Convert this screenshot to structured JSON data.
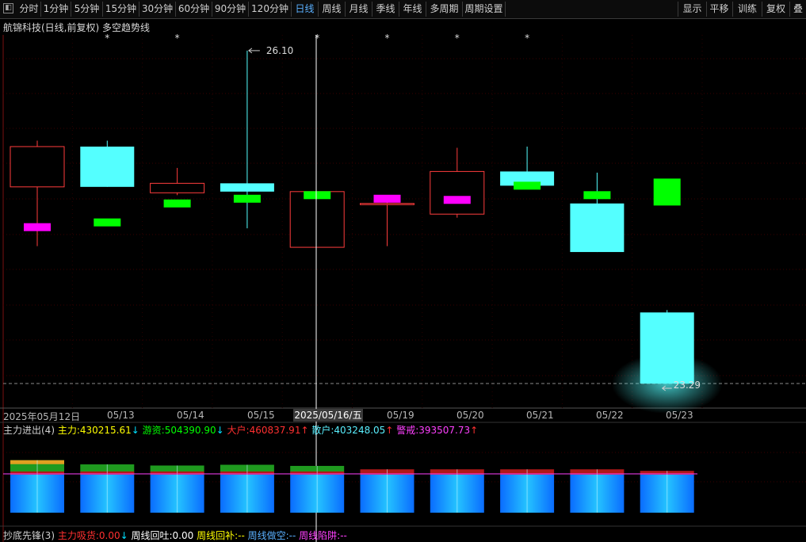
{
  "toolbar": {
    "collapse_glyph": "◧",
    "left_buttons": [
      "分时",
      "1分钟",
      "5分钟",
      "15分钟",
      "30分钟",
      "60分钟",
      "90分钟",
      "120分钟",
      "日线",
      "周线",
      "月线",
      "季线",
      "年线",
      "多周期",
      "周期设置"
    ],
    "active": "日线",
    "right_buttons": [
      "显示",
      "平移",
      "训练",
      "复权",
      "叠"
    ]
  },
  "chart_title": "航锦科技(日线,前复权) 多空趋势线",
  "markers": {
    "star": "*",
    "high_label": "26.10",
    "low_label": "23.29"
  },
  "dates": {
    "first": "2025年05月12日",
    "labels": [
      "05/13",
      "05/14",
      "05/15",
      "05/19",
      "05/20",
      "05/21",
      "05/22",
      "05/23"
    ],
    "highlight": "2025/05/16/五"
  },
  "indicator1": {
    "name": "主力进出(4)",
    "items": [
      {
        "label": "主力:",
        "value": "430215.61",
        "arrow": "↓",
        "color": "#ffff00"
      },
      {
        "label": "游资:",
        "value": "504390.90",
        "arrow": "↓",
        "color": "#00ff00"
      },
      {
        "label": "大户:",
        "value": "460837.91",
        "arrow": "↑",
        "color": "#ff3030"
      },
      {
        "label": "散户:",
        "value": "403248.05",
        "arrow": "↑",
        "color": "#5af0ff"
      },
      {
        "label": "警戒:",
        "value": "393507.73",
        "arrow": "↑",
        "color": "#ff40ff"
      }
    ]
  },
  "indicator2": {
    "name": "抄底先锋(3)",
    "items": [
      {
        "text": "主力吸货:0.00",
        "arrow": "↓",
        "color": "#ff3030"
      },
      {
        "text": "周线回吐:0.00",
        "arrow": "",
        "color": "#ffffff"
      },
      {
        "text": "周线回补:--",
        "arrow": "",
        "color": "#ffff00"
      },
      {
        "text": "周线做空:--",
        "arrow": "",
        "color": "#5ab0ff"
      },
      {
        "text": "周线陷阱:--",
        "arrow": "",
        "color": "#ff40ff"
      }
    ]
  },
  "colors": {
    "up": "#ff3d3d",
    "down": "#54ffff",
    "green": "#00ff00",
    "magenta": "#ff00ff",
    "volume": "#1aa0ff"
  },
  "chart_data": {
    "type": "candlestick",
    "dates": [
      "05/12",
      "05/13",
      "05/14",
      "05/15",
      "05/16",
      "05/19",
      "05/20",
      "05/21",
      "05/22",
      "05/23"
    ],
    "ohlc": [
      {
        "o": 24.95,
        "h": 25.34,
        "l": 24.45,
        "c": 25.29
      },
      {
        "o": 25.29,
        "h": 25.34,
        "l": 24.95,
        "c": 24.95
      },
      {
        "o": 24.9,
        "h": 25.11,
        "l": 24.88,
        "c": 24.98
      },
      {
        "o": 24.98,
        "h": 26.1,
        "l": 24.6,
        "c": 24.91
      },
      {
        "o": 24.44,
        "h": 24.91,
        "l": 24.44,
        "c": 24.91
      },
      {
        "o": 24.8,
        "h": 24.83,
        "l": 24.45,
        "c": 24.81
      },
      {
        "o": 24.72,
        "h": 25.28,
        "l": 24.69,
        "c": 25.08
      },
      {
        "o": 25.08,
        "h": 25.29,
        "l": 24.96,
        "c": 24.96
      },
      {
        "o": 24.81,
        "h": 25.07,
        "l": 24.4,
        "c": 24.4
      },
      {
        "o": 23.89,
        "h": 23.91,
        "l": 23.29,
        "c": 23.29
      }
    ],
    "trend_line": [
      24.61,
      24.65,
      24.81,
      24.85,
      24.88,
      24.85,
      24.84,
      24.96,
      24.88,
      24.72
    ],
    "reference_line": 23.29,
    "volume": {
      "base": [
        100,
        100,
        100,
        100,
        100,
        100,
        100,
        100,
        100,
        100
      ],
      "total": [
        138,
        127,
        124,
        126,
        123,
        114,
        114,
        114,
        114,
        110
      ]
    }
  }
}
